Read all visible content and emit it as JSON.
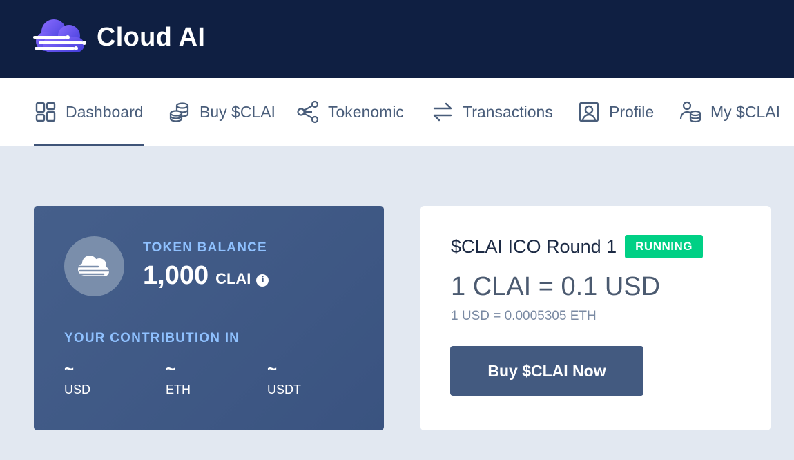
{
  "brand": {
    "name": "Cloud AI",
    "logo_icon": "cloud-circuit-logo"
  },
  "nav": {
    "items": [
      {
        "label": "Dashboard",
        "icon": "grid-icon",
        "active": true
      },
      {
        "label": "Buy $CLAI",
        "icon": "coins-icon",
        "active": false
      },
      {
        "label": "Tokenomic",
        "icon": "share-nodes-icon",
        "active": false
      },
      {
        "label": "Transactions",
        "icon": "arrows-exchange-icon",
        "active": false
      },
      {
        "label": "Profile",
        "icon": "user-card-icon",
        "active": false
      },
      {
        "label": "My $CLAI",
        "icon": "user-coins-icon",
        "active": false
      }
    ]
  },
  "balance": {
    "label": "TOKEN BALANCE",
    "amount": "1,000",
    "unit": "CLAI",
    "info_glyph": "i",
    "contribution_label": "YOUR CONTRIBUTION IN",
    "contributions": [
      {
        "amount": "~",
        "currency": "USD"
      },
      {
        "amount": "~",
        "currency": "ETH"
      },
      {
        "amount": "~",
        "currency": "USDT"
      }
    ]
  },
  "ico": {
    "title": "$CLAI ICO Round 1",
    "status": "RUNNING",
    "rate": "1 CLAI = 0.1 USD",
    "eth_rate": "1 USD = 0.0005305 ETH",
    "button_label": "Buy $CLAI Now"
  },
  "colors": {
    "topbar": "#0f1f42",
    "accent_label": "#8fc1ff",
    "badge_running": "#00d085",
    "button": "#435a80"
  }
}
